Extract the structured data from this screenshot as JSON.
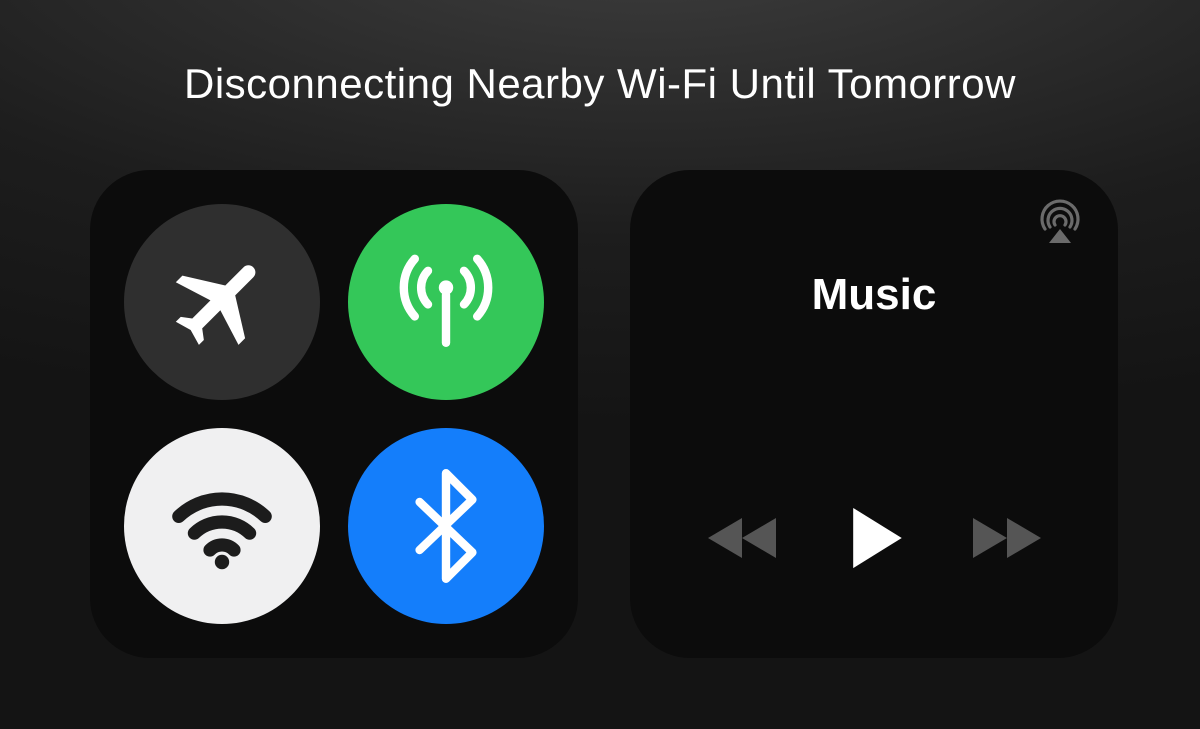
{
  "status_text": "Disconnecting Nearby Wi-Fi Until Tomorrow",
  "connectivity": {
    "airplane": {
      "name": "airplane-mode",
      "active": false,
      "icon": "airplane-icon"
    },
    "cellular": {
      "name": "cellular-data",
      "active": true,
      "icon": "cellular-antenna-icon"
    },
    "wifi": {
      "name": "wifi",
      "active": false,
      "icon": "wifi-icon"
    },
    "bluetooth": {
      "name": "bluetooth",
      "active": true,
      "icon": "bluetooth-icon"
    }
  },
  "music": {
    "title": "Music",
    "airplay_icon": "airplay-icon",
    "controls": {
      "prev": "rewind-icon",
      "play": "play-icon",
      "next": "fast-forward-icon"
    }
  },
  "colors": {
    "active_green": "#34c759",
    "active_blue": "#147efb",
    "inactive_gray": "#2f2f2f",
    "off_white": "#f0f0f1"
  }
}
